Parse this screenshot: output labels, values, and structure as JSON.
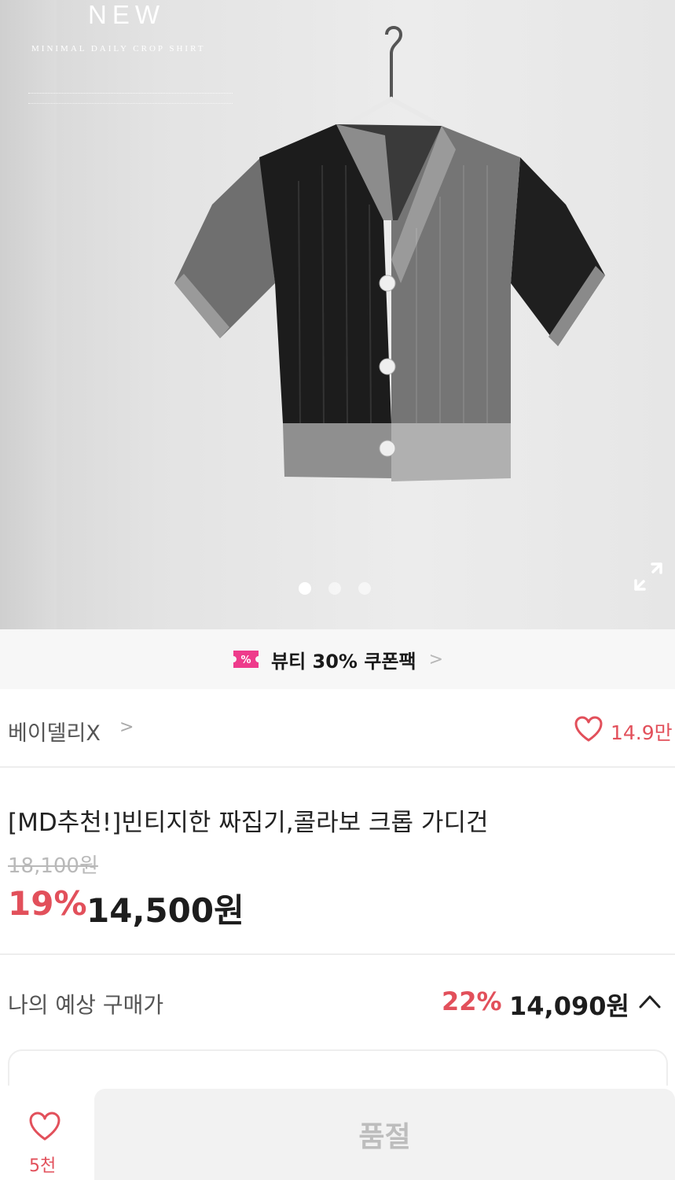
{
  "hero": {
    "overlay_title": "NEW",
    "overlay_subtitle": "MINIMAL DAILY CROP SHIRT",
    "carousel_dots": 3,
    "active_dot": 1,
    "expand_icon": "fullscreen-expand-icon"
  },
  "coupon": {
    "icon": "coupon-ticket-icon",
    "label": "뷰티 30% 쿠폰팩",
    "chevron": ">"
  },
  "seller": {
    "name": "베이델리X",
    "chevron": ">",
    "like_icon": "heart-outline-icon",
    "like_count": "14.9만"
  },
  "product": {
    "title": "[MD추천!]빈티지한 짜집기,콜라보 크롭 가디건",
    "original_price": "18,100원",
    "discount": "19%",
    "price": "14,500원"
  },
  "expected": {
    "label": "나의 예상 구매가",
    "discount": "22%",
    "price": "14,090원",
    "chevron_icon": "chevron-up-icon"
  },
  "bottom_bar": {
    "wish_icon": "heart-outline-icon",
    "wish_count": "5천",
    "status_label": "품절"
  },
  "colors": {
    "accent": "#e2505b",
    "coupon_pink": "#ee3b8b",
    "text_dark": "#1d1d1d",
    "muted": "#bdbdbd"
  }
}
